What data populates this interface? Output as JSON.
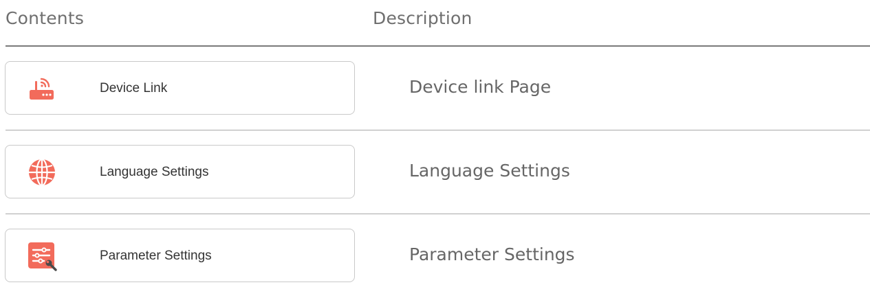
{
  "header": {
    "contents_label": "Contents",
    "description_label": "Description"
  },
  "rows": [
    {
      "button_label": "Device Link",
      "icon": "router-wifi-icon",
      "description": "Device link Page"
    },
    {
      "button_label": "Language Settings",
      "icon": "globe-icon",
      "description": "Language Settings"
    },
    {
      "button_label": "Parameter Settings",
      "icon": "parameter-settings-icon",
      "description": "Parameter Settings"
    }
  ],
  "colors": {
    "accent": "#f26b5b",
    "header_text": "#6f6f6f",
    "label_text": "#333333",
    "description_text": "#666666",
    "card_border": "#c9c9c9",
    "divider": "#a8a8a8"
  }
}
